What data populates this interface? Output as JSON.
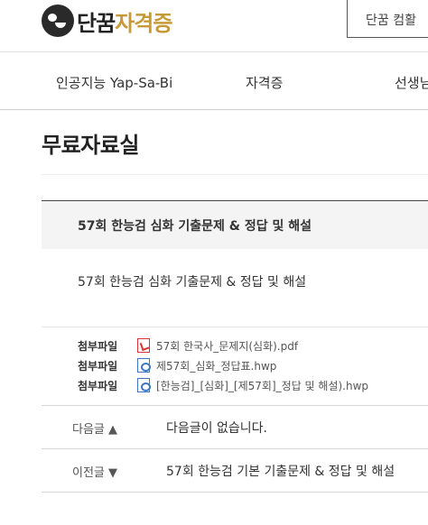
{
  "header": {
    "logo": {
      "text_main": "단꿈",
      "text_accent": "자격증"
    },
    "top_button": "단꿈 컴활"
  },
  "nav": {
    "items": [
      "인공지능 Yap-Sa-Bi",
      "자격증",
      "선생님"
    ]
  },
  "page_title": "무료자료실",
  "article": {
    "title": "57회 한능검 심화 기출문제 & 정답 및 해설",
    "body": "57회 한능검 심화 기출문제 & 정답 및 해설",
    "attachments": [
      {
        "label": "첨부파일",
        "icon": "pdf-file-icon",
        "filename": "57회 한국사_문제지(심화).pdf"
      },
      {
        "label": "첨부파일",
        "icon": "hwp-file-icon",
        "filename": "제57회_심화_정답표.hwp"
      },
      {
        "label": "첨부파일",
        "icon": "hwp-file-icon",
        "filename": "[한능검]_[심화]_[제57회]_정답 및 해설).hwp"
      }
    ]
  },
  "pager": {
    "next": {
      "label": "다음글 ▲",
      "text": "다음글이 없습니다."
    },
    "prev": {
      "label": "이전글 ▼",
      "text": "57회 한능검 기본 기출문제 & 정답 및 해설"
    }
  },
  "colors": {
    "accent": "#c79a38",
    "pdf": "#dd3333",
    "hwp": "#3a78c2"
  }
}
